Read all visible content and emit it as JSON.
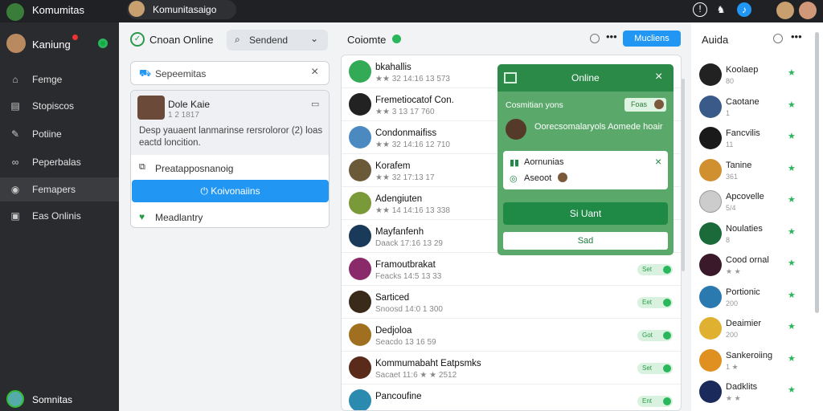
{
  "topbar": {
    "app_title": "Komumitas",
    "search_value": "Komunitasaigo"
  },
  "sidebar": {
    "user_name": "Kaniung",
    "items": [
      {
        "label": "Femge",
        "icon": "home-icon"
      },
      {
        "label": "Stopiscos",
        "icon": "document-icon"
      },
      {
        "label": "Potiine",
        "icon": "pencil-icon"
      },
      {
        "label": "Peperbalas",
        "icon": "link-icon"
      },
      {
        "label": "Femapers",
        "icon": "eye-icon"
      },
      {
        "label": "Eas Onlinis",
        "icon": "video-icon"
      }
    ],
    "footer_label": "Somnitas"
  },
  "left": {
    "header": "Cnoan Online",
    "search_placeholder": "Sendend",
    "filter_value": "Sepeemitas",
    "card": {
      "name": "Dole Kaie",
      "sub": "1 2 1817",
      "desc": "Desp yauaent lanmarinse rersroloror (2) loas eactd loncition.",
      "row1": "Preatapposnanoig",
      "button": "Koivonaiins",
      "row2": "Meadlantry"
    }
  },
  "middle": {
    "header": "Coiomte",
    "button": "Mucliens",
    "items": [
      {
        "name": "bkahallis",
        "stats": "★★ 32 14:16 13 573",
        "tag": "",
        "color": "#3a5"
      },
      {
        "name": "Fremetiocatof Con.",
        "stats": "★★ 3 13 17 760",
        "tag": "",
        "color": "#222"
      },
      {
        "name": "Condonmaifiss",
        "stats": "★★ 32 14:16 12 710",
        "tag": "",
        "color": "#4a8ac0"
      },
      {
        "name": "Korafem",
        "stats": "★★ 32 17:13 17",
        "tag": "",
        "color": "#6a5a3a"
      },
      {
        "name": "Adengiuten",
        "stats": "★★ 14 14:16 13 338",
        "tag": "",
        "color": "#7a9a3a"
      },
      {
        "name": "Mayfanfenh",
        "stats": "Daack 17:16 13 29",
        "tag": "",
        "color": "#1a3a5a"
      },
      {
        "name": "Framoutbrakat",
        "stats": "Feacks 14:5 13 33",
        "tag": "Set",
        "color": "#8a2a6a"
      },
      {
        "name": "Sarticed",
        "stats": "Snoosd 14:0 1 300",
        "tag": "Eet",
        "color": "#3a2a1a"
      },
      {
        "name": "Dedjoloa",
        "stats": "Seacdo 13 16 59",
        "tag": "Got",
        "color": "#a07020"
      },
      {
        "name": "Kommumabaht Eatpsmks",
        "stats": "Sacaet 11:6 ★ ★ 2512",
        "tag": "Set",
        "color": "#5a2a1a"
      },
      {
        "name": "Pancoufine",
        "stats": "",
        "tag": "Ent",
        "color": "#2a8ab0"
      }
    ]
  },
  "popup": {
    "title": "Online",
    "label": "Cosmitian yons",
    "chip": "Foas",
    "message": "Oorecsomalaryols Aomede hoair",
    "box_line1": "Aornunias",
    "box_line2": "Aseoot",
    "primary": "Si Uant",
    "secondary": "Sad"
  },
  "right": {
    "title": "Auida",
    "items": [
      {
        "name": "Koolaep",
        "sub": "80",
        "color": "#222"
      },
      {
        "name": "Caotane",
        "sub": "1",
        "color": "#3a5a8a"
      },
      {
        "name": "Fancvilis",
        "sub": "11",
        "color": "#1a1a1a"
      },
      {
        "name": "Tanine",
        "sub": "361",
        "color": "#d09030"
      },
      {
        "name": "Apcovelle",
        "sub": "5/4",
        "color": "#cccccc"
      },
      {
        "name": "Noulaties",
        "sub": "8",
        "color": "#1a6a3a"
      },
      {
        "name": "Cood ornal",
        "sub": "★ ★",
        "color": "#3a1a2a"
      },
      {
        "name": "Portionic",
        "sub": "200",
        "color": "#2a7ab0"
      },
      {
        "name": "Deaimier",
        "sub": "200",
        "color": "#e0b030"
      },
      {
        "name": "Sankeroiing",
        "sub": "1 ★",
        "color": "#e09020"
      },
      {
        "name": "Dadklits",
        "sub": "★ ★",
        "color": "#1a2a5a"
      }
    ]
  },
  "colors": {
    "accent": "#2196f3",
    "green": "#2ab65a",
    "popup": "#5aa96a"
  }
}
